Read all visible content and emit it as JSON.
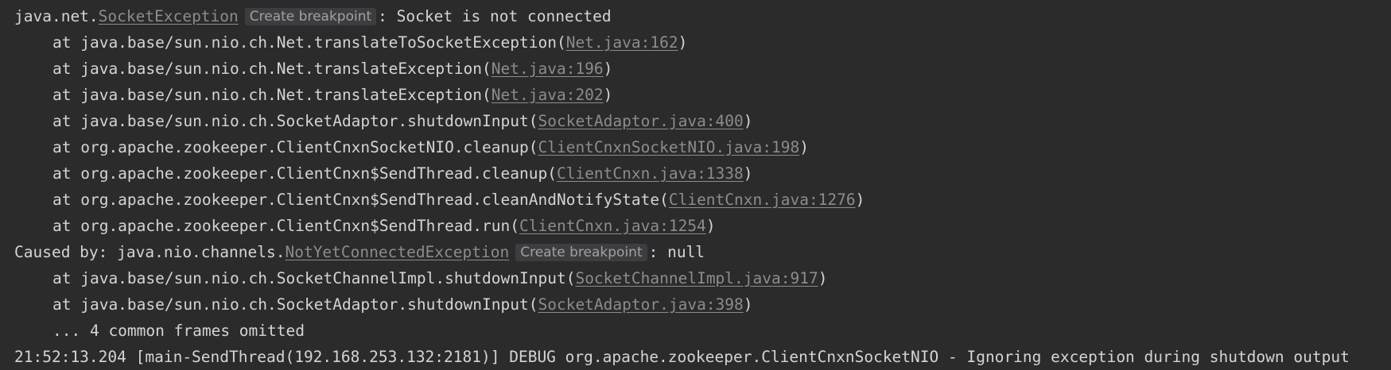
{
  "console": {
    "exception": {
      "prefix": "java.net.",
      "class_link": "SocketException",
      "breakpoint_label": "Create breakpoint",
      "message": ": Socket is not connected"
    },
    "frames_main": [
      {
        "text": "at java.base/sun.nio.ch.Net.translateToSocketException(",
        "link": "Net.java:162",
        "suffix": ")"
      },
      {
        "text": "at java.base/sun.nio.ch.Net.translateException(",
        "link": "Net.java:196",
        "suffix": ")"
      },
      {
        "text": "at java.base/sun.nio.ch.Net.translateException(",
        "link": "Net.java:202",
        "suffix": ")"
      },
      {
        "text": "at java.base/sun.nio.ch.SocketAdaptor.shutdownInput(",
        "link": "SocketAdaptor.java:400",
        "suffix": ")"
      },
      {
        "text": "at org.apache.zookeeper.ClientCnxnSocketNIO.cleanup(",
        "link": "ClientCnxnSocketNIO.java:198",
        "suffix": ")"
      },
      {
        "text": "at org.apache.zookeeper.ClientCnxn$SendThread.cleanup(",
        "link": "ClientCnxn.java:1338",
        "suffix": ")"
      },
      {
        "text": "at org.apache.zookeeper.ClientCnxn$SendThread.cleanAndNotifyState(",
        "link": "ClientCnxn.java:1276",
        "suffix": ")"
      },
      {
        "text": "at org.apache.zookeeper.ClientCnxn$SendThread.run(",
        "link": "ClientCnxn.java:1254",
        "suffix": ")"
      }
    ],
    "caused_by": {
      "prefix": "Caused by: java.nio.channels.",
      "class_link": "NotYetConnectedException",
      "breakpoint_label": "Create breakpoint",
      "message": ": null"
    },
    "frames_cause": [
      {
        "text": "at java.base/sun.nio.ch.SocketChannelImpl.shutdownInput(",
        "link": "SocketChannelImpl.java:917",
        "suffix": ")"
      },
      {
        "text": "at java.base/sun.nio.ch.SocketAdaptor.shutdownInput(",
        "link": "SocketAdaptor.java:398",
        "suffix": ")"
      }
    ],
    "omitted": "... 4 common frames omitted",
    "log_line": "21:52:13.204 [main-SendThread(192.168.253.132:2181)] DEBUG org.apache.zookeeper.ClientCnxnSocketNIO - Ignoring exception during shutdown output"
  }
}
